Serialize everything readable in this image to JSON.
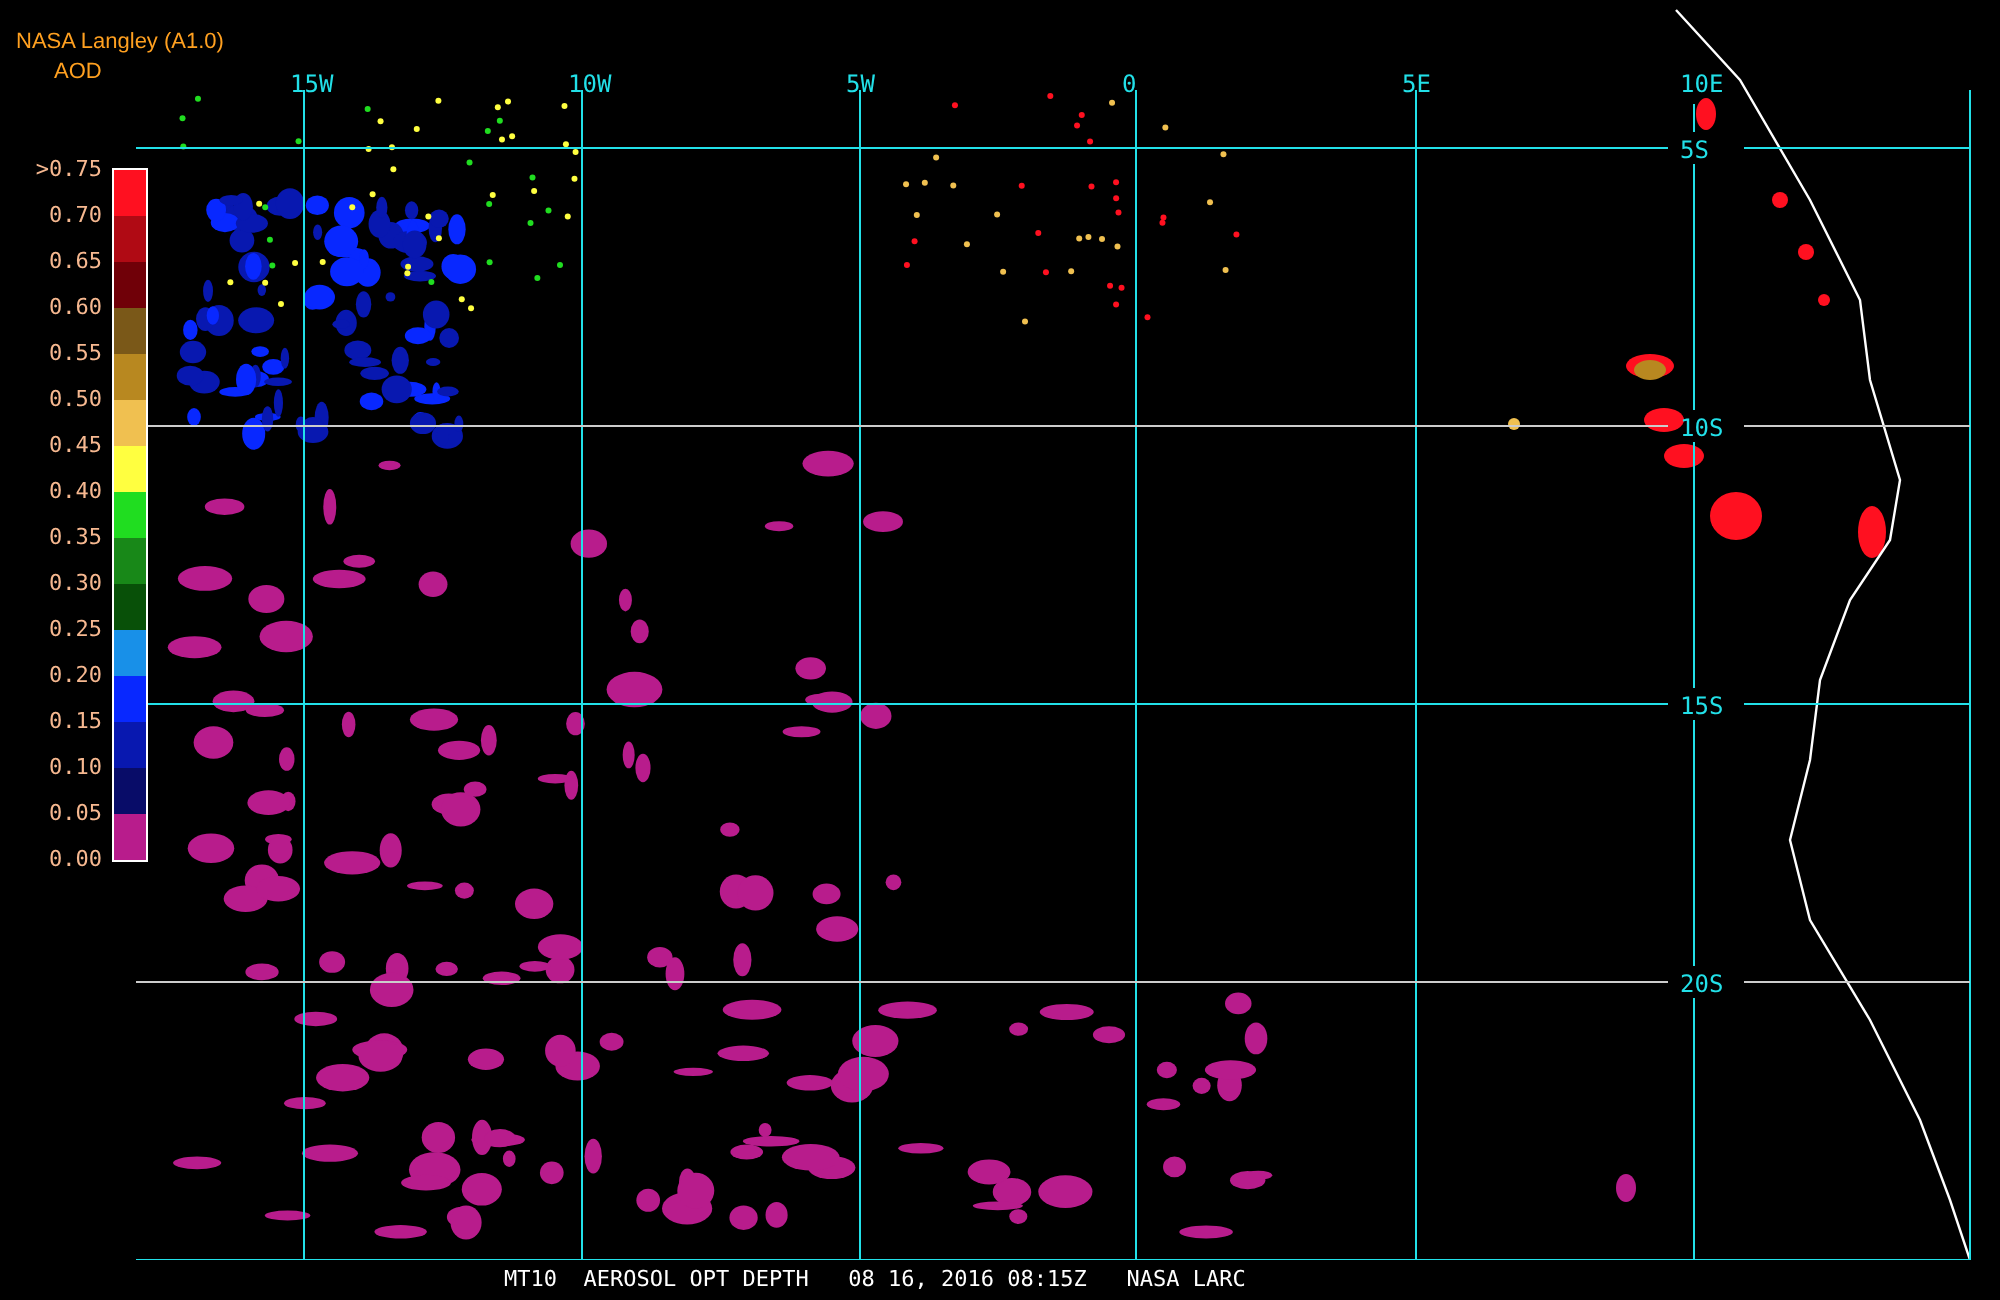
{
  "header": {
    "source": "NASA Langley (A1.0)",
    "product": "AOD"
  },
  "legend": {
    "ticks": [
      ">0.75",
      "0.70",
      "0.65",
      "0.60",
      "0.55",
      "0.50",
      "0.45",
      "0.40",
      "0.35",
      "0.30",
      "0.25",
      "0.20",
      "0.15",
      "0.10",
      "0.05",
      "0.00"
    ],
    "bins": [
      {
        "color": "#ff1020"
      },
      {
        "color": "#b00a14"
      },
      {
        "color": "#700008"
      },
      {
        "color": "#7a5818"
      },
      {
        "color": "#b88820"
      },
      {
        "color": "#f0c050"
      },
      {
        "color": "#ffff40"
      },
      {
        "color": "#20dd20"
      },
      {
        "color": "#188818"
      },
      {
        "color": "#085008"
      },
      {
        "color": "#1890e8"
      },
      {
        "color": "#0828ff"
      },
      {
        "color": "#0818b0"
      },
      {
        "color": "#080c68"
      },
      {
        "color": "#b81c8c"
      }
    ]
  },
  "map": {
    "lon_labels": [
      "15W",
      "10W",
      "5W",
      "0",
      "5E",
      "10E"
    ],
    "lat_labels": [
      "5S",
      "10S",
      "15S",
      "20S"
    ]
  },
  "footer": "MT10  AEROSOL OPT DEPTH   08 16, 2016 08:15Z   NASA LARC"
}
